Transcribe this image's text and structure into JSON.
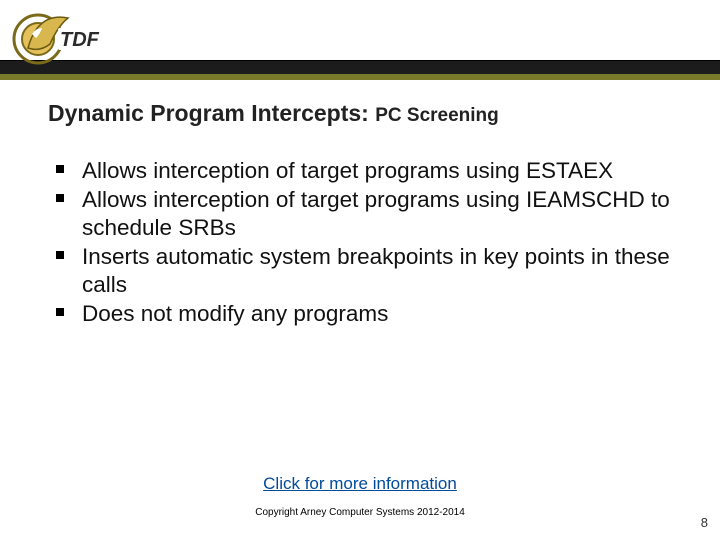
{
  "header": {
    "logo_text": "TDF"
  },
  "title": {
    "main": "Dynamic Program Intercepts:",
    "sub": "PC Screening"
  },
  "bullets": [
    "Allows interception of target programs using ESTAEX",
    "Allows interception of target programs using IEAMSCHD to schedule SRBs",
    "Inserts automatic system breakpoints in key points in these calls",
    "Does not modify any programs"
  ],
  "link": {
    "label": "Click for more information"
  },
  "footer": {
    "copyright": "Copyright Arney Computer Systems 2012-2014",
    "page": "8"
  }
}
